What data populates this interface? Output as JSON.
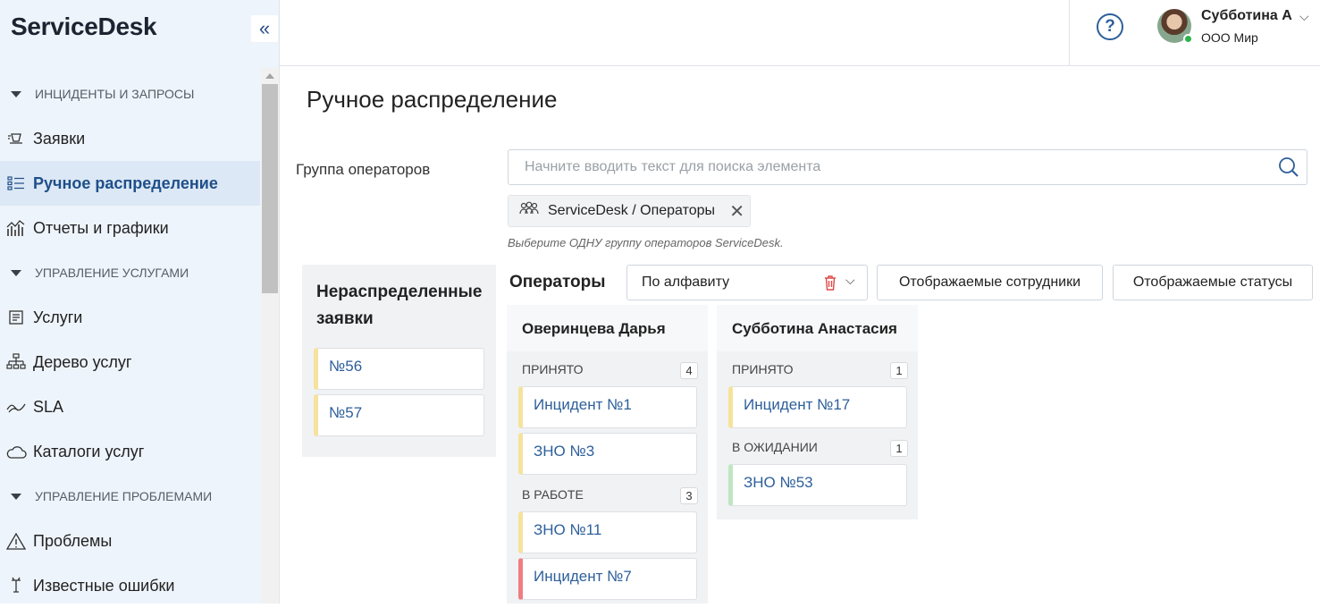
{
  "app": {
    "brand": "ServiceDesk",
    "collapse_glyph": "«"
  },
  "sidebar": {
    "sections": [
      {
        "label": "ИНЦИДЕНТЫ И ЗАПРОСЫ"
      },
      {
        "label": "УПРАВЛЕНИЕ УСЛУГАМИ"
      },
      {
        "label": "УПРАВЛЕНИЕ ПРОБЛЕМАМИ"
      }
    ],
    "items": [
      {
        "label": "Заявки",
        "icon": "requests-icon"
      },
      {
        "label": "Ручное распределение",
        "icon": "distribution-icon",
        "active": true
      },
      {
        "label": "Отчеты и графики",
        "icon": "chart-icon"
      },
      {
        "label": "Услуги",
        "icon": "services-icon"
      },
      {
        "label": "Дерево услуг",
        "icon": "tree-icon"
      },
      {
        "label": "SLA",
        "icon": "sla-icon"
      },
      {
        "label": "Каталоги услуг",
        "icon": "cloud-icon"
      },
      {
        "label": "Проблемы",
        "icon": "warning-icon"
      },
      {
        "label": "Известные ошибки",
        "icon": "bug-icon"
      }
    ]
  },
  "header": {
    "help_glyph": "?",
    "user_name": "Субботина А",
    "user_company": "ООО Мир",
    "chevron": "⌵"
  },
  "page": {
    "title": "Ручное распределение",
    "group_label": "Группа операторов",
    "search_placeholder": "Начните вводить текст для поиска элемента",
    "chip_label": "ServiceDesk / Операторы",
    "chip_remove": "✕",
    "hint": "Выберите ОДНУ группу операторов ServiceDesk."
  },
  "unassigned": {
    "title": "Нераспределенные заявки",
    "items": [
      "№56",
      "№57"
    ]
  },
  "operators": {
    "label": "Операторы",
    "sort_value": "По алфавиту",
    "sort_chevron": "⌵",
    "btn_employees": "Отображаемые сотрудники",
    "btn_statuses": "Отображаемые статусы",
    "columns": [
      {
        "name": "Оверинцева Дарья",
        "groups": [
          {
            "status": "ПРИНЯТО",
            "count": "4",
            "items": [
              "Инцидент №1",
              "ЗНО №3"
            ]
          },
          {
            "status": "В РАБОТЕ",
            "count": "3",
            "items": [
              "ЗНО №11",
              "Инцидент №7"
            ]
          }
        ]
      },
      {
        "name": "Субботина Анастасия",
        "groups": [
          {
            "status": "ПРИНЯТО",
            "count": "1",
            "items": [
              "Инцидент №17"
            ]
          },
          {
            "status": "В ОЖИДАНИИ",
            "count": "1",
            "items": [
              "ЗНО №53"
            ]
          }
        ]
      }
    ]
  },
  "colors": {
    "accent": "#2d5f9a",
    "card_yellow": "#f6e39b",
    "card_red": "#ee7e80",
    "card_green": "#bfe6c2",
    "online": "#2bb34a"
  }
}
